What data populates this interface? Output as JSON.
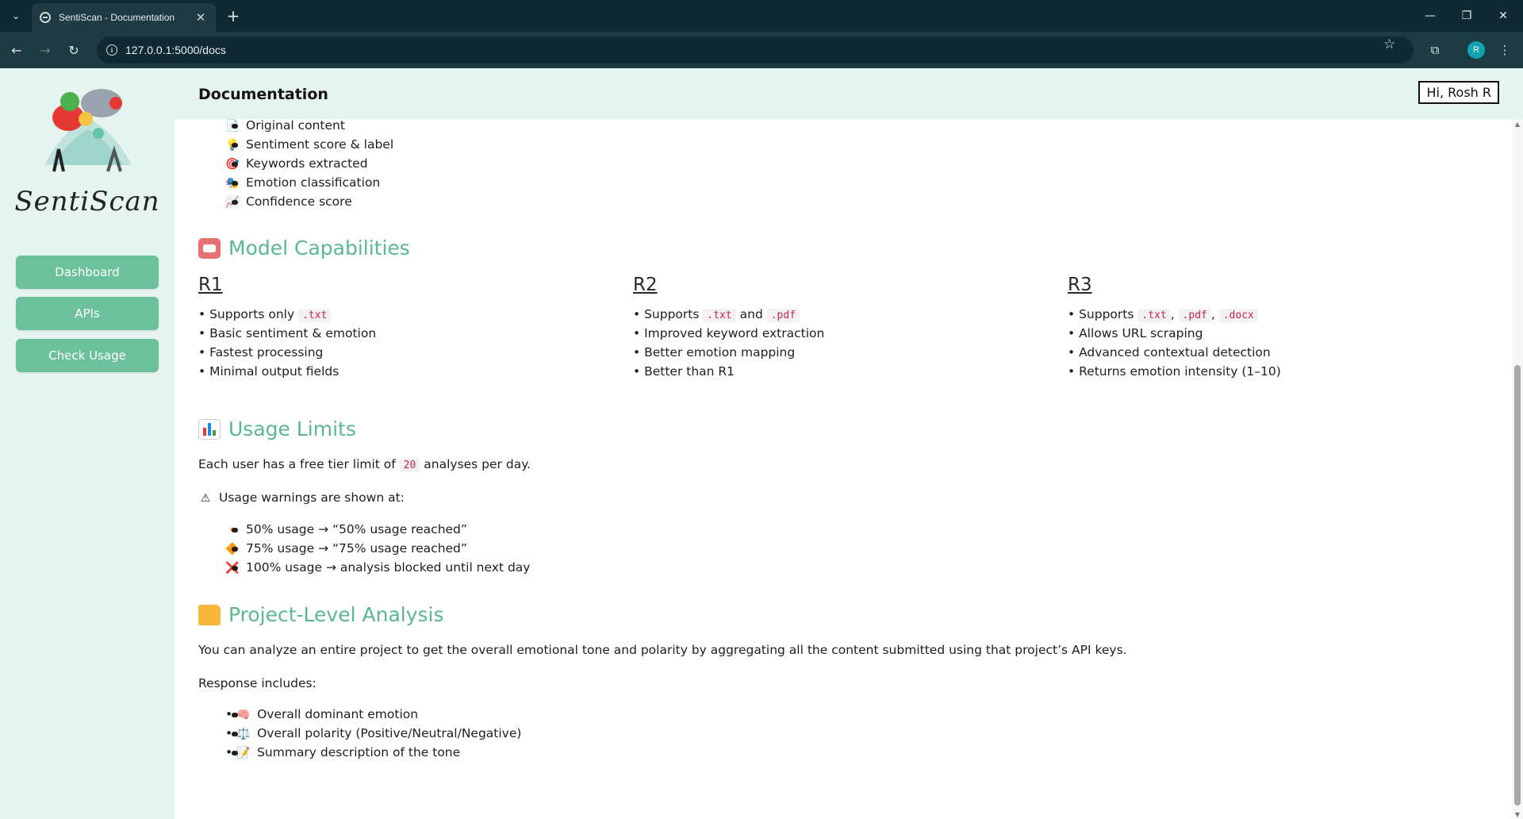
{
  "browser": {
    "tab_title": "SentiScan - Documentation",
    "url": "127.0.0.1:5000/docs",
    "profile_initial": "R"
  },
  "sidebar": {
    "brand": "SentiScan",
    "items": [
      {
        "label": "Dashboard"
      },
      {
        "label": "APIs"
      },
      {
        "label": "Check Usage"
      }
    ]
  },
  "header": {
    "title": "Documentation",
    "greeting": "Hi, Rosh R"
  },
  "response_fields": [
    {
      "icon": "📄",
      "text": "Original content"
    },
    {
      "icon": "💡",
      "text": "Sentiment score & label"
    },
    {
      "icon": "🎯",
      "text": "Keywords extracted"
    },
    {
      "icon": "🎭",
      "text": "Emotion classification"
    },
    {
      "icon": "📈",
      "text": "Confidence score"
    }
  ],
  "model_capabilities": {
    "heading": "Model Capabilities",
    "models": [
      {
        "name": "R1",
        "lines": [
          "Supports only",
          "Basic sentiment & emotion",
          "Fastest processing",
          "Minimal output fields"
        ],
        "formats": [
          ".txt"
        ]
      },
      {
        "name": "R2",
        "lines": [
          "Supports",
          "and",
          "Improved keyword extraction",
          "Better emotion mapping",
          "Better than R1"
        ],
        "formats": [
          ".txt",
          ".pdf"
        ]
      },
      {
        "name": "R3",
        "lines": [
          "Supports",
          "Allows URL scraping",
          "Advanced contextual detection",
          "Returns emotion intensity (1–10)"
        ],
        "formats": [
          ".txt",
          ".pdf",
          ".docx"
        ]
      }
    ]
  },
  "usage_limits": {
    "heading": "Usage Limits",
    "intro_pre": "Each user has a free tier limit of",
    "limit": "20",
    "intro_post": "analyses per day.",
    "warning_intro": "Usage warnings are shown at:",
    "warnings": [
      {
        "icon": "🔸",
        "text": "50% usage → “50% usage reached”"
      },
      {
        "icon": "🔶",
        "text": "75% usage → “75% usage reached”"
      },
      {
        "icon": "❌",
        "text": "100% usage → analysis blocked until next day"
      }
    ]
  },
  "project_analysis": {
    "heading": "Project-Level Analysis",
    "description": "You can analyze an entire project to get the overall emotional tone and polarity by aggregating all the content submitted using that project’s API keys.",
    "response_intro": "Response includes:",
    "items": [
      {
        "icon": "🧠",
        "text": "Overall dominant emotion"
      },
      {
        "icon": "⚖️",
        "text": "Overall polarity (Positive/Neutral/Negative)"
      },
      {
        "icon": "📝",
        "text": "Summary description of the tone"
      }
    ]
  },
  "colors": {
    "accent": "#5ab88d",
    "button": "#6cc19c",
    "panel": "#e6f4f0",
    "code_text": "#c7254e"
  }
}
